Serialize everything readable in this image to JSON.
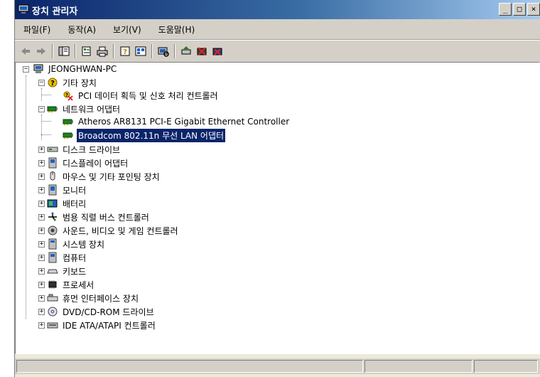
{
  "window": {
    "title": "장치 관리자",
    "controls": {
      "minimize": "_",
      "maximize": "□",
      "close": "×"
    }
  },
  "menu": [
    "파일(F)",
    "동작(A)",
    "보기(V)",
    "도움말(H)"
  ],
  "toolbar": [
    {
      "icon": "back-arrow-icon"
    },
    {
      "icon": "forward-arrow-icon"
    },
    {
      "icon": "console-tree-icon"
    },
    {
      "icon": "properties-icon"
    },
    {
      "icon": "print-icon"
    },
    {
      "icon": "help-icon"
    },
    {
      "icon": "view-icon"
    },
    {
      "icon": "scan-hardware-icon"
    },
    {
      "icon": "update-driver-icon"
    },
    {
      "icon": "disable-device-icon"
    },
    {
      "icon": "uninstall-device-icon"
    }
  ],
  "tree": {
    "root": "JEONGHWAN-PC",
    "categories": [
      {
        "label": "기타 장치",
        "icon": "unknown-device-icon",
        "expanded": true,
        "children": [
          {
            "label": "PCI 데이터 획득 및 신호 처리 컨트롤러",
            "icon": "warning-device-icon"
          }
        ]
      },
      {
        "label": "네트워크 어댑터",
        "icon": "network-adapter-icon",
        "expanded": true,
        "children": [
          {
            "label": "Atheros AR8131 PCI-E Gigabit Ethernet Controller",
            "icon": "network-adapter-icon",
            "selected": false
          },
          {
            "label": "Broadcom 802.11n 무선 LAN 어댑터",
            "icon": "network-adapter-icon",
            "selected": true
          }
        ]
      },
      {
        "label": "디스크 드라이브",
        "icon": "disk-drive-icon"
      },
      {
        "label": "디스플레이 어댑터",
        "icon": "display-adapter-icon"
      },
      {
        "label": "마우스 및 기타 포인팅 장치",
        "icon": "mouse-icon"
      },
      {
        "label": "모니터",
        "icon": "monitor-icon"
      },
      {
        "label": "배터리",
        "icon": "battery-icon"
      },
      {
        "label": "범용 직렬 버스 컨트롤러",
        "icon": "usb-icon"
      },
      {
        "label": "사운드, 비디오 및 게임 컨트롤러",
        "icon": "sound-icon"
      },
      {
        "label": "시스템 장치",
        "icon": "system-device-icon"
      },
      {
        "label": "컴퓨터",
        "icon": "computer-icon"
      },
      {
        "label": "키보드",
        "icon": "keyboard-icon"
      },
      {
        "label": "프로세서",
        "icon": "processor-icon"
      },
      {
        "label": "휴먼 인터페이스 장치",
        "icon": "hid-icon"
      },
      {
        "label": "DVD/CD-ROM 드라이브",
        "icon": "cdrom-icon"
      },
      {
        "label": "IDE ATA/ATAPI 컨트롤러",
        "icon": "ide-controller-icon"
      }
    ]
  },
  "colors": {
    "title_bar_start": "#0a246a",
    "title_bar_end": "#a6caf0",
    "selection": "#0a246a",
    "chrome": "#d4d0c8"
  }
}
